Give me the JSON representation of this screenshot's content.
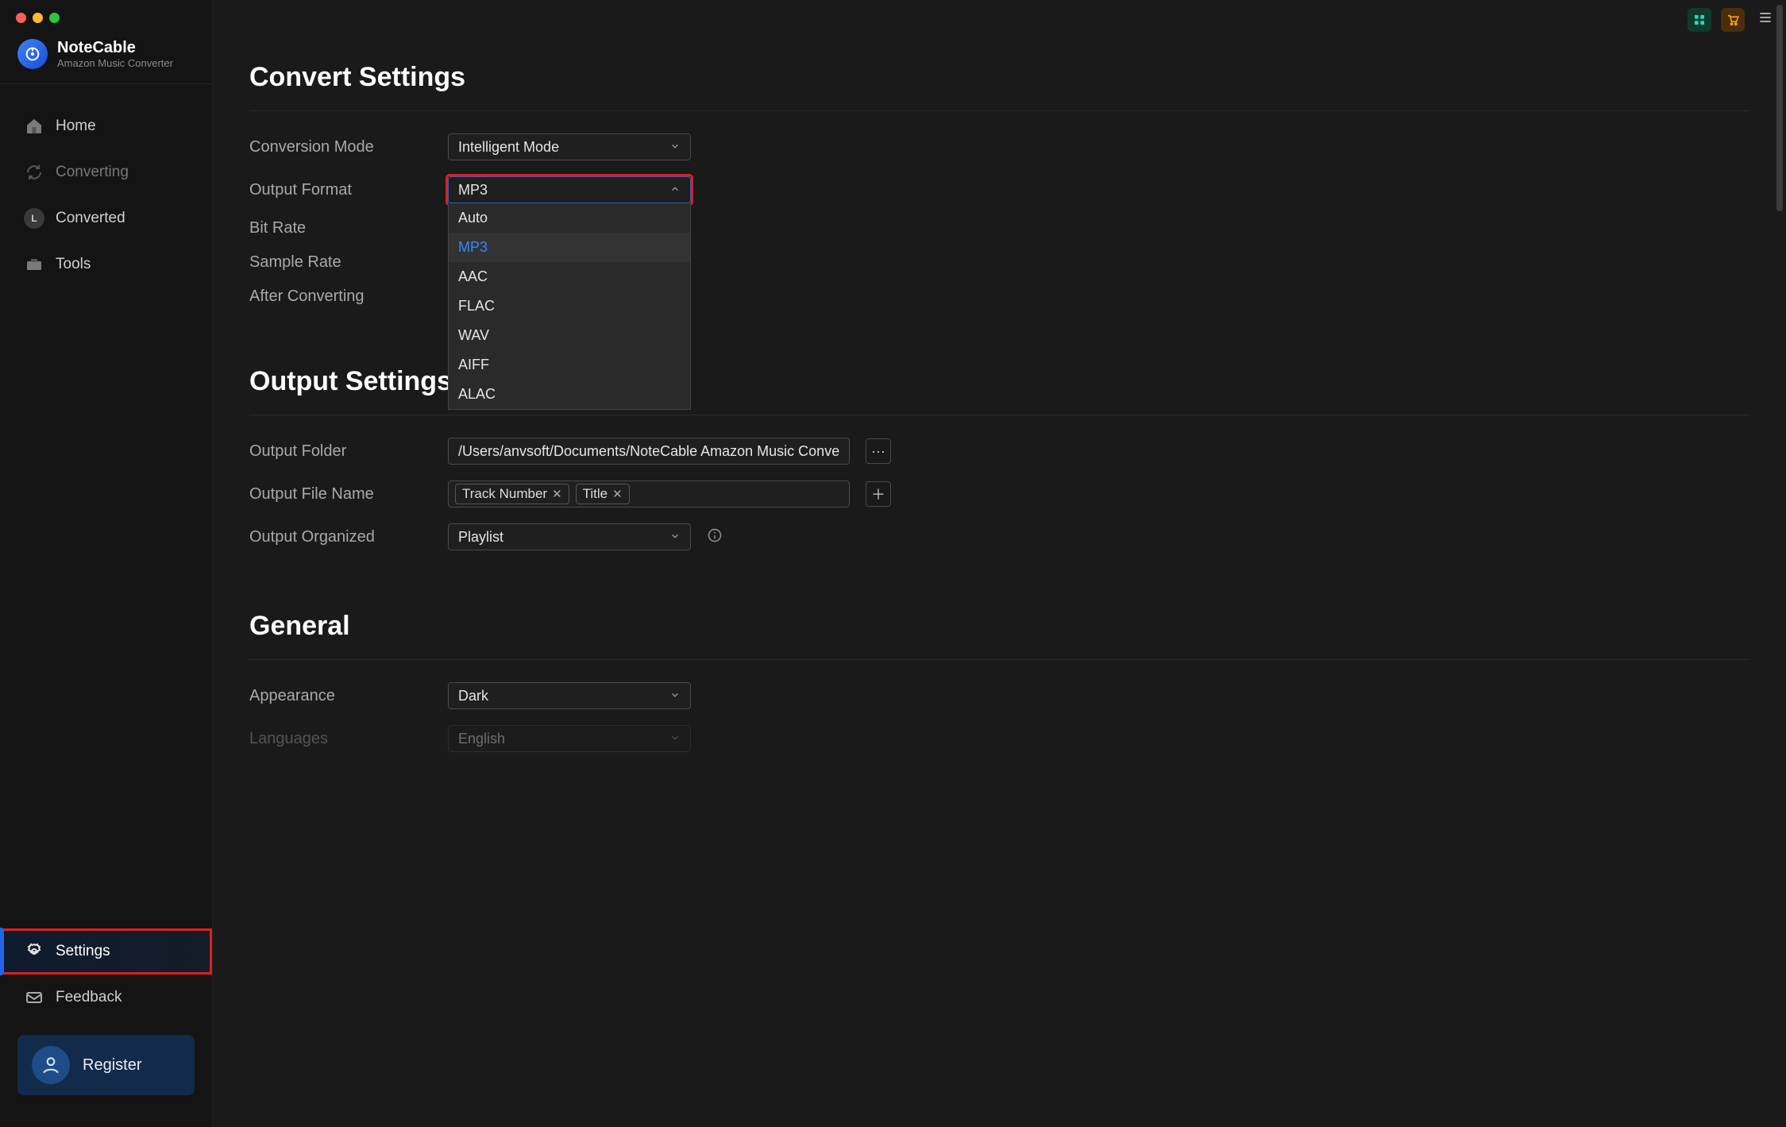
{
  "brand": {
    "name": "NoteCable",
    "sub": "Amazon Music Converter"
  },
  "sidebar": {
    "items": [
      {
        "label": "Home"
      },
      {
        "label": "Converting"
      },
      {
        "label": "Converted",
        "badge": "L"
      },
      {
        "label": "Tools"
      }
    ],
    "lower": [
      {
        "label": "Settings"
      },
      {
        "label": "Feedback"
      }
    ],
    "register": "Register"
  },
  "sections": {
    "convert": {
      "title": "Convert Settings",
      "conversion_mode": {
        "label": "Conversion Mode",
        "value": "Intelligent Mode"
      },
      "output_format": {
        "label": "Output Format",
        "value": "MP3",
        "options": [
          "Auto",
          "MP3",
          "AAC",
          "FLAC",
          "WAV",
          "AIFF",
          "ALAC"
        ]
      },
      "bit_rate": {
        "label": "Bit Rate"
      },
      "sample_rate": {
        "label": "Sample Rate"
      },
      "after_converting": {
        "label": "After Converting"
      }
    },
    "output": {
      "title": "Output Settings",
      "output_folder": {
        "label": "Output Folder",
        "value": "/Users/anvsoft/Documents/NoteCable Amazon Music Conve"
      },
      "output_file_name": {
        "label": "Output File Name",
        "tags": [
          "Track Number",
          "Title"
        ]
      },
      "output_organized": {
        "label": "Output Organized",
        "value": "Playlist"
      }
    },
    "general": {
      "title": "General",
      "appearance": {
        "label": "Appearance",
        "value": "Dark"
      },
      "languages": {
        "label": "Languages",
        "value": "English"
      }
    }
  },
  "icons": {
    "browse": "···",
    "plus": "＋",
    "close_tag": "✕"
  }
}
